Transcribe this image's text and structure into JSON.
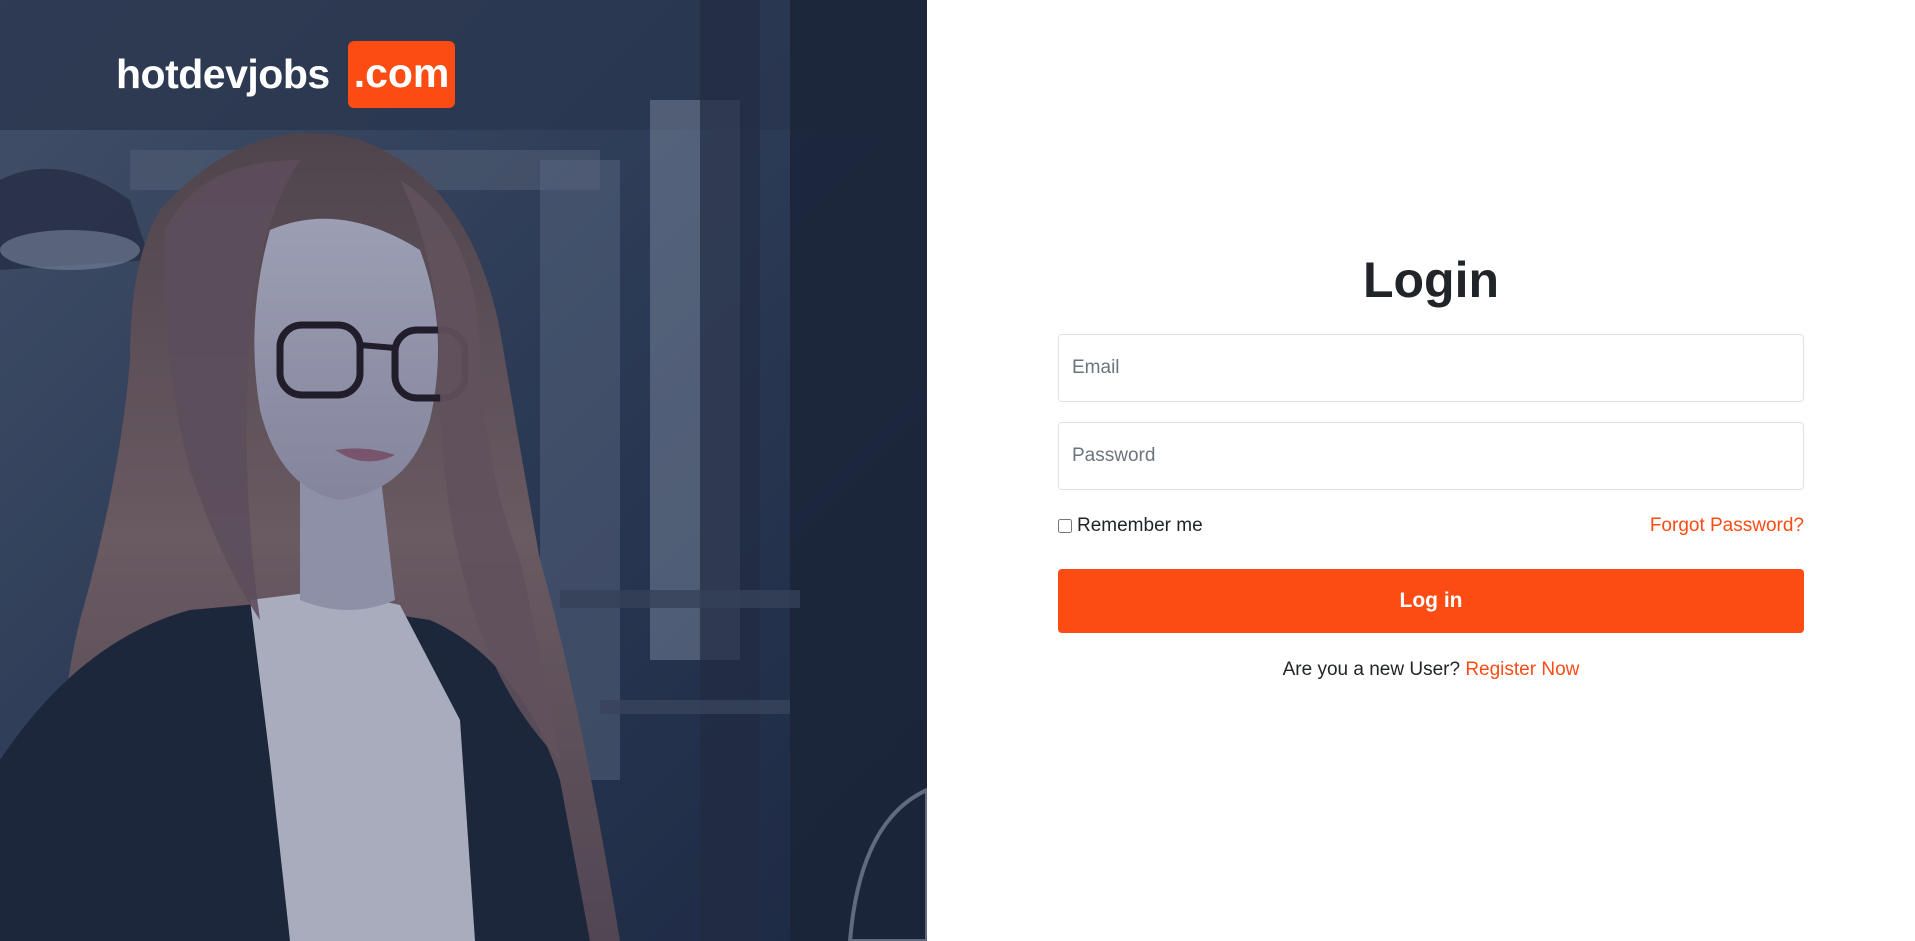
{
  "brand": {
    "name": "hotdevjobs",
    "tld": ".com",
    "accent_color": "#fc4c14"
  },
  "hero": {
    "image": "photo-of-woman-with-glasses",
    "overlay_color": "#1f2d48"
  },
  "login": {
    "title": "Login",
    "email_placeholder": "Email",
    "email_value": "",
    "password_placeholder": "Password",
    "password_value": "",
    "remember_label": "Remember me",
    "remember_checked": false,
    "forgot_label": "Forgot Password?",
    "submit_label": "Log in",
    "register_prompt": "Are you a new User?",
    "register_link": "Register Now"
  }
}
